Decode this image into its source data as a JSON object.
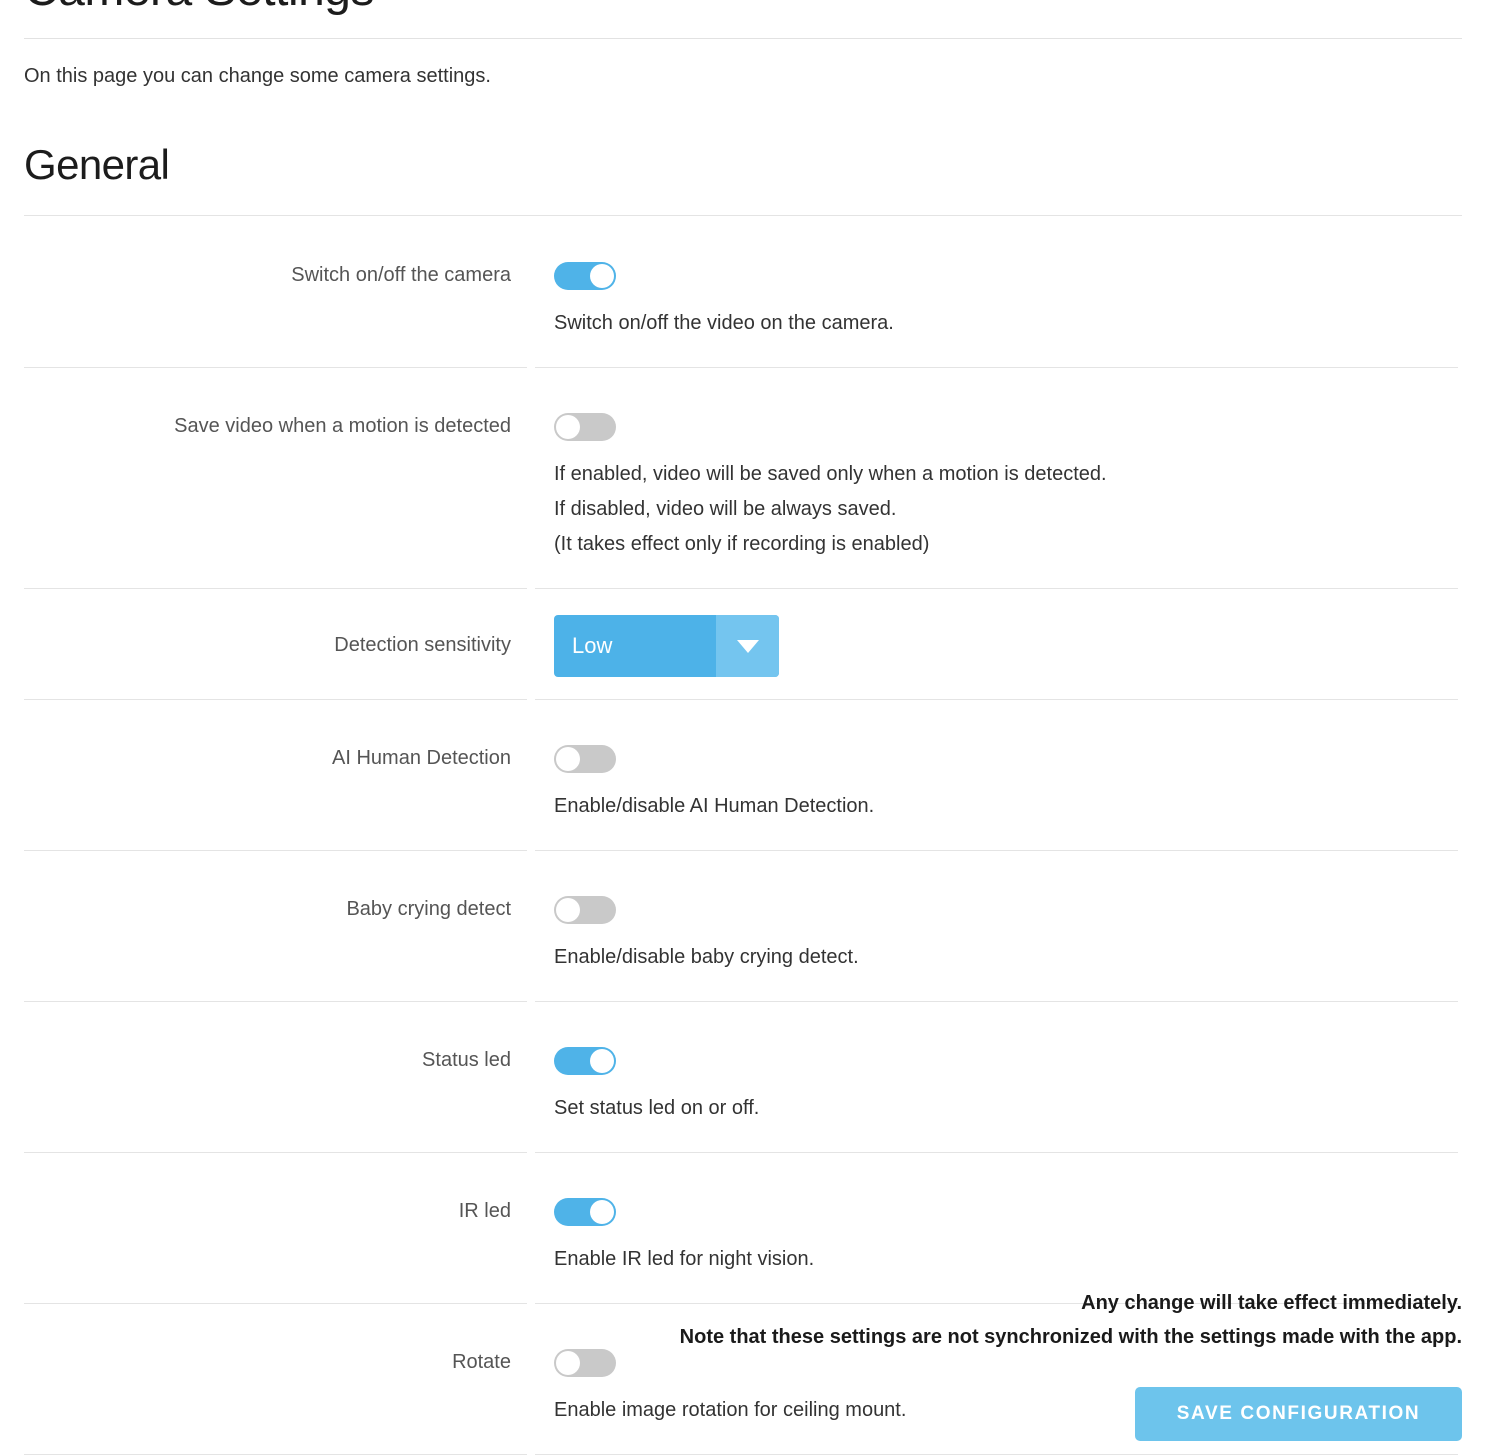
{
  "page": {
    "title": "Camera Settings",
    "intro": "On this page you can change some camera settings."
  },
  "section": {
    "heading": "General"
  },
  "rows": [
    {
      "label": "Switch on/off the camera",
      "control": "toggle",
      "state": "on",
      "desc": [
        "Switch on/off the video on the camera."
      ]
    },
    {
      "label": "Save video when a motion is detected",
      "control": "toggle",
      "state": "off",
      "desc": [
        "If enabled, video will be saved only when a motion is detected.",
        "If disabled, video will be always saved.",
        "(It takes effect only if recording is enabled)"
      ]
    },
    {
      "label": "Detection sensitivity",
      "control": "select",
      "value": "Low",
      "desc": []
    },
    {
      "label": "AI Human Detection",
      "control": "toggle",
      "state": "off",
      "desc": [
        "Enable/disable AI Human Detection."
      ]
    },
    {
      "label": "Baby crying detect",
      "control": "toggle",
      "state": "off",
      "desc": [
        "Enable/disable baby crying detect."
      ]
    },
    {
      "label": "Status led",
      "control": "toggle",
      "state": "on",
      "desc": [
        "Set status led on or off."
      ]
    },
    {
      "label": "IR led",
      "control": "toggle",
      "state": "on",
      "desc": [
        "Enable IR led for night vision."
      ]
    },
    {
      "label": "Rotate",
      "control": "toggle",
      "state": "off",
      "desc": [
        "Enable image rotation for ceiling mount."
      ]
    }
  ],
  "footer": {
    "note_line1": "Any change will take effect immediately.",
    "note_line2": "Note that these settings are not synchronized with the settings made with the app."
  },
  "actions": {
    "save_label": "Save configuration"
  },
  "colors": {
    "accent": "#4fb3e8",
    "accent_light": "#74c5ef",
    "button": "#6dc4ec",
    "toggle_off": "#c9c9c9",
    "divider": "#e4e4e4",
    "label_text": "#555555",
    "body_text": "#333333"
  },
  "icons": {
    "dropdown": "chevron-down-icon"
  }
}
